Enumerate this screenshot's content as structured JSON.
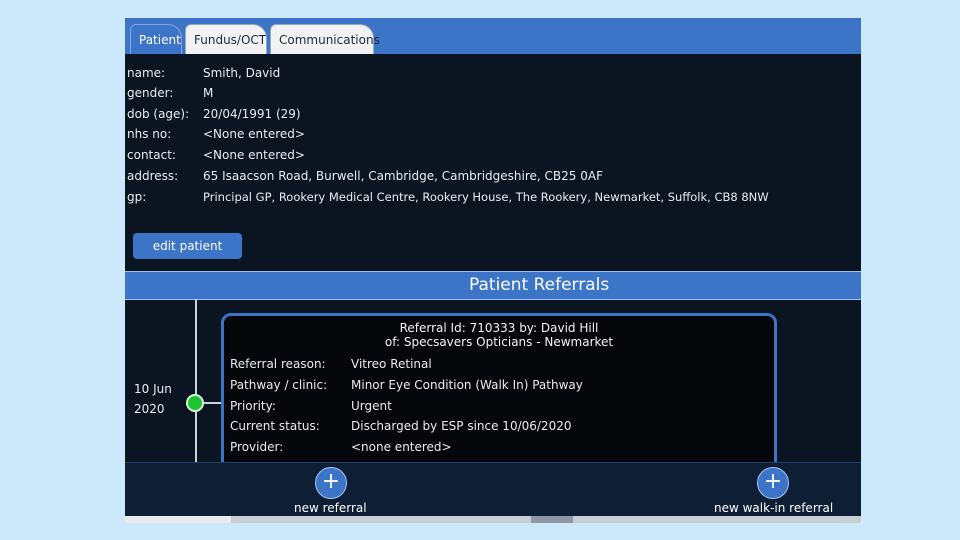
{
  "tabs": [
    {
      "label": "Patient",
      "active": true
    },
    {
      "label": "Fundus/OCT",
      "active": false
    },
    {
      "label": "Communications",
      "active": false
    }
  ],
  "patient": {
    "rows": [
      {
        "label": "name:",
        "value": "Smith, David"
      },
      {
        "label": "gender:",
        "value": "M"
      },
      {
        "label": "dob (age):",
        "value": "20/04/1991 (29)"
      },
      {
        "label": "nhs no:",
        "value": "<None entered>"
      },
      {
        "label": "contact:",
        "value": "<None entered>"
      },
      {
        "label": "address:",
        "value": "65 Isaacson Road, Burwell, Cambridge, Cambridgeshire, CB25 0AF"
      },
      {
        "label": "gp:",
        "value": "Principal GP, Rookery Medical Centre, Rookery House, The Rookery, Newmarket, Suffolk, CB8 8NW"
      }
    ],
    "edit_label": "edit patient"
  },
  "referrals": {
    "title": "Patient Referrals",
    "date_day": "10 Jun",
    "date_year": "2020",
    "card": {
      "title_line1": "Referral Id: 710333 by: David Hill",
      "title_line2": "of: Specsavers Opticians - Newmarket",
      "rows": [
        {
          "label": "Referral reason:",
          "value": "Vitreo Retinal"
        },
        {
          "label": "Pathway / clinic:",
          "value": "Minor Eye Condition (Walk In) Pathway"
        },
        {
          "label": "Priority:",
          "value": "Urgent"
        },
        {
          "label": "Current status:",
          "value": "Discharged by ESP since 10/06/2020"
        },
        {
          "label": "Provider:",
          "value": "<none entered>"
        }
      ]
    }
  },
  "footer": {
    "plus_glyph": "+",
    "new_referral_label": "new referral",
    "new_walkin_label": "new walk-in referral"
  },
  "colors": {
    "accent": "#3c74c8",
    "status_dot": "#1fc231",
    "background": "#0b1522"
  }
}
